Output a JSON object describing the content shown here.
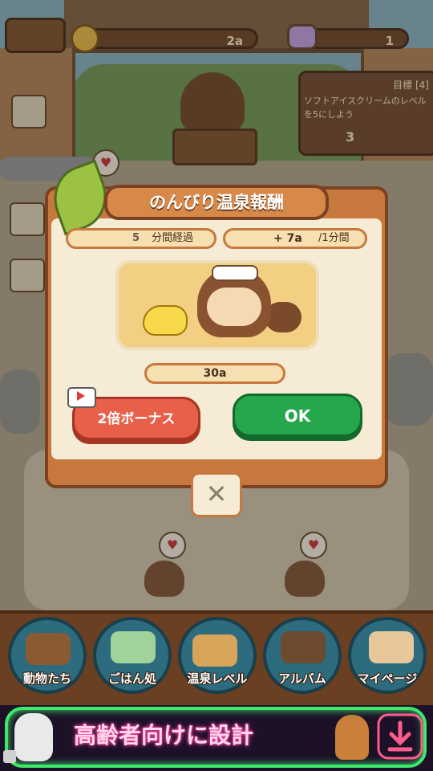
{
  "hud": {
    "coins": "2a",
    "gems": "1"
  },
  "goal": {
    "title": "目標 [4]",
    "text": "ソフトアイスクリームのレベルを5にしよう",
    "reward": "3"
  },
  "modal": {
    "title": "のんびり温泉報酬",
    "elapsed_value": "5",
    "elapsed_label": "分間経過",
    "rate_value": "+ 7a",
    "rate_label": "/1分間",
    "reward_total": "30a",
    "bonus_button": "2倍ボーナス",
    "ok_button": "OK",
    "close_symbol": "✕"
  },
  "nav": {
    "items": [
      {
        "label": "動物たち",
        "icon": "animals-icon"
      },
      {
        "label": "ごはん処",
        "icon": "food-icon"
      },
      {
        "label": "温泉レベル",
        "icon": "onsen-level-icon"
      },
      {
        "label": "アルバム",
        "icon": "album-icon"
      },
      {
        "label": "マイページ",
        "icon": "mypage-icon"
      }
    ]
  },
  "ad": {
    "text": "高齢者向けに設計"
  },
  "bubbles": {
    "heart": "♥"
  },
  "colors": {
    "modal_orange": "#c7783e",
    "ok_green": "#25a84b",
    "bonus_red": "#e9604a",
    "ad_neon_green": "#3ee86b"
  }
}
